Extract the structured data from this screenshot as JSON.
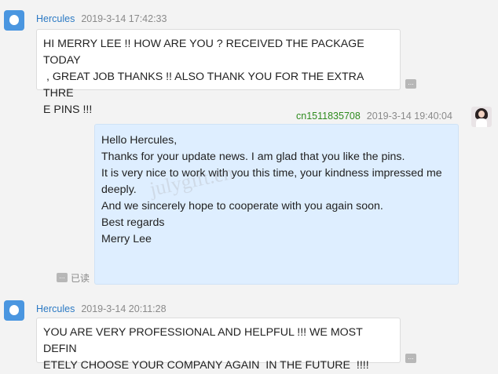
{
  "messages": [
    {
      "sender": "Hercules",
      "time": "2019-3-14 17:42:33",
      "lines": [
        "HI MERRY LEE !! HOW ARE YOU ? RECEIVED THE PACKAGE TODAY",
        " , GREAT JOB THANKS !! ALSO THANK YOU FOR THE EXTRA THRE",
        "E PINS !!!"
      ]
    },
    {
      "sender": "cn1511835708",
      "time": "2019-3-14 19:40:04",
      "read_status": "已读",
      "lines": [
        "Hello Hercules,",
        "",
        "Thanks for your update news. I am glad that you like the pins.",
        "It is very nice to work with you this time, your kindness impressed me",
        "deeply.",
        "And we sincerely hope to cooperate with you again soon.",
        "",
        "Best regards",
        "Merry Lee"
      ]
    },
    {
      "sender": "Hercules",
      "time": "2019-3-14 20:11:28",
      "lines": [
        "YOU ARE VERY PROFESSIONAL AND HELPFUL !!! WE MOST DEFIN",
        "ETELY CHOOSE YOUR COMPANY AGAIN  IN THE FUTURE  !!!!"
      ]
    }
  ],
  "more_label": "...",
  "watermark": "julygift.en",
  "colors": {
    "incoming_name": "#2c7ac4",
    "outgoing_name": "#2e8b1e",
    "outgoing_bubble": "#deeeff",
    "incoming_bubble": "#ffffff",
    "background": "#f3f3f3"
  },
  "icons": {
    "incoming_avatar": "avatar-icon",
    "outgoing_avatar": "user-photo-icon",
    "more": "more-options-icon"
  }
}
